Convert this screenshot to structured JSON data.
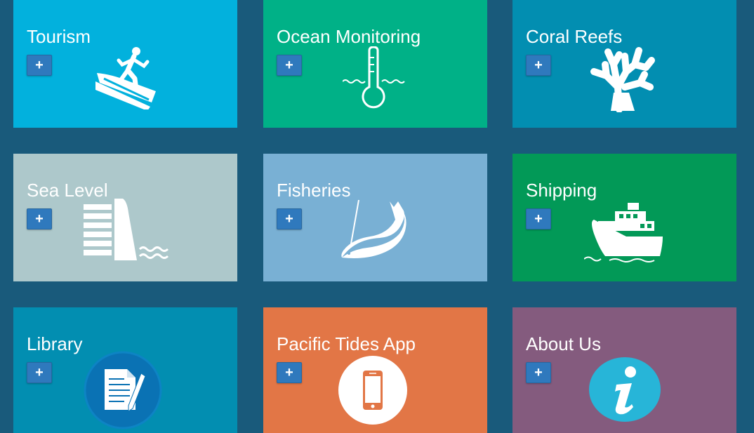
{
  "tiles": [
    {
      "title": "Tourism",
      "button": "+",
      "color": "#02b1dd",
      "icon": "surfer-icon"
    },
    {
      "title": "Ocean Monitoring",
      "button": "+",
      "color": "#00b187",
      "icon": "thermometer-icon"
    },
    {
      "title": "Coral Reefs",
      "button": "+",
      "color": "#028eb1",
      "icon": "coral-icon"
    },
    {
      "title": "Sea Level",
      "button": "+",
      "color": "#adc8cb",
      "icon": "sea-wall-icon"
    },
    {
      "title": "Fisheries",
      "button": "+",
      "color": "#79b0d4",
      "icon": "fish-icon"
    },
    {
      "title": "Shipping",
      "button": "+",
      "color": "#029957",
      "icon": "ship-icon"
    },
    {
      "title": "Library",
      "button": "+",
      "color": "#028eb1",
      "icon": "document-icon"
    },
    {
      "title": "Pacific Tides App",
      "button": "+",
      "color": "#e27646",
      "icon": "smartphone-icon"
    },
    {
      "title": "About Us",
      "button": "+",
      "color": "#845b7e",
      "icon": "info-icon"
    }
  ],
  "colors": {
    "background": "#195a7b",
    "button": "#2f79bd"
  }
}
